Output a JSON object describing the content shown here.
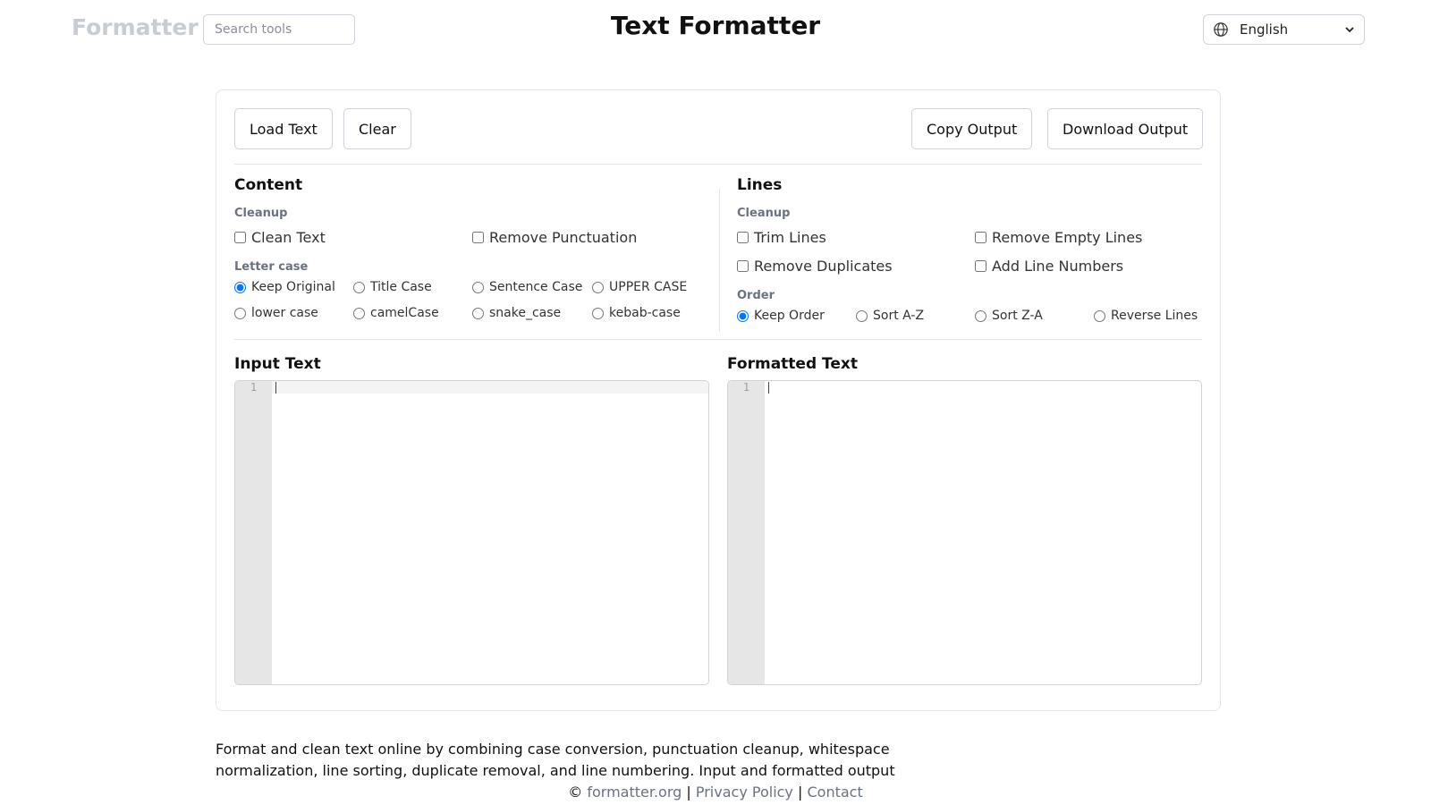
{
  "header": {
    "brand": "Formatter",
    "search_placeholder": "Search tools",
    "title": "Text Formatter",
    "language": "English"
  },
  "toolbar": {
    "load_label": "Load Text",
    "clear_label": "Clear",
    "copy_label": "Copy Output",
    "download_label": "Download Output"
  },
  "content": {
    "title": "Content",
    "cleanup_title": "Cleanup",
    "clean_text": "Clean Text",
    "remove_punctuation": "Remove Punctuation",
    "letter_case_title": "Letter case",
    "cases": [
      "Keep Original",
      "Title Case",
      "Sentence Case",
      "UPPER CASE",
      "lower case",
      "camelCase",
      "snake_case",
      "kebab-case"
    ],
    "selected_case": "Keep Original"
  },
  "lines": {
    "title": "Lines",
    "cleanup_title": "Cleanup",
    "trim_lines": "Trim Lines",
    "remove_empty_lines": "Remove Empty Lines",
    "remove_duplicates": "Remove Duplicates",
    "add_line_numbers": "Add Line Numbers",
    "order_title": "Order",
    "orders": [
      "Keep Order",
      "Sort A-Z",
      "Sort Z-A",
      "Reverse Lines"
    ],
    "selected_order": "Keep Order"
  },
  "input": {
    "label": "Input Text",
    "line_number": "1"
  },
  "output": {
    "label": "Formatted Text",
    "line_number": "1"
  },
  "footer": {
    "description": "Format and clean text online by combining case conversion, punctuation cleanup, whitespace normalization, line sorting, duplicate removal, and line numbering. Input and formatted output",
    "copyright": "©",
    "site_link": "formatter.org",
    "sep": "|",
    "privacy": "Privacy Policy",
    "contact": "Contact"
  },
  "colors": {
    "accent": "#1a73e8",
    "muted": "#6b7280",
    "border": "#d0d4da"
  }
}
